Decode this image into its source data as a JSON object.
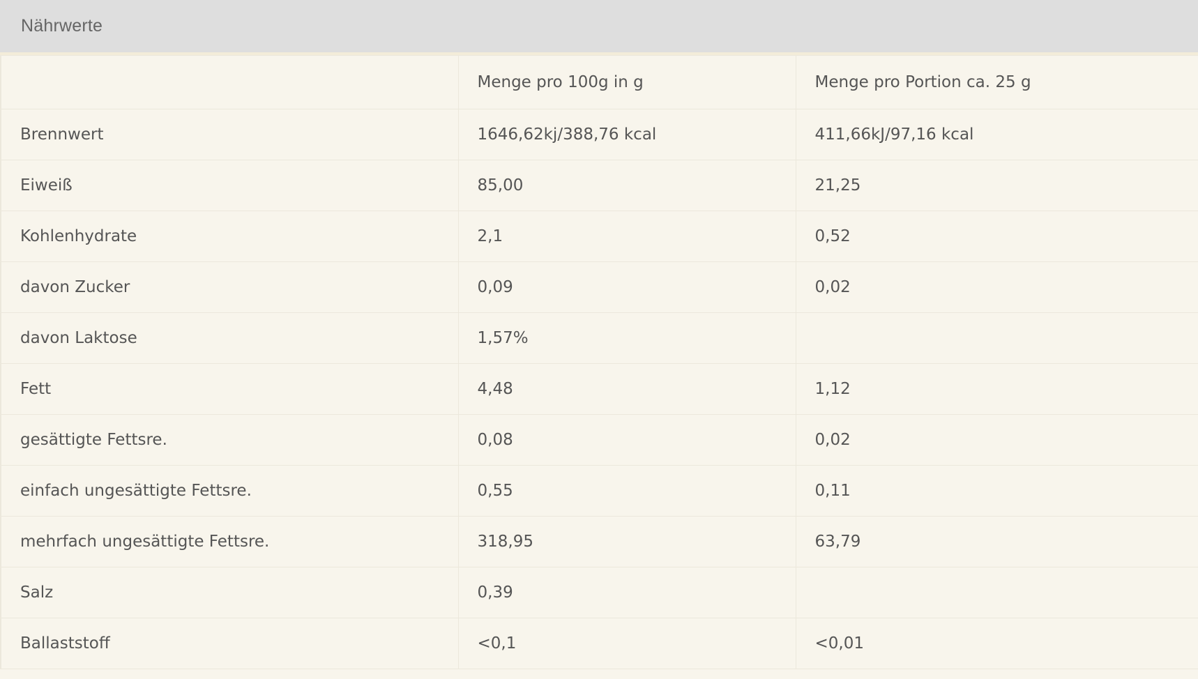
{
  "panel": {
    "title": "Nährwerte"
  },
  "table": {
    "headers": [
      "",
      "Menge pro 100g in g",
      "Menge pro Portion ca. 25 g"
    ],
    "rows": [
      [
        "Brennwert",
        "1646,62kj/388,76 kcal",
        "411,66kJ/97,16 kcal"
      ],
      [
        "Eiweiß",
        "85,00",
        "21,25"
      ],
      [
        "Kohlenhydrate",
        "2,1",
        "0,52"
      ],
      [
        "davon Zucker",
        "0,09",
        "0,02"
      ],
      [
        "davon Laktose",
        "1,57%",
        ""
      ],
      [
        "Fett",
        "4,48",
        "1,12"
      ],
      [
        "gesättigte Fettsre.",
        "0,08",
        "0,02"
      ],
      [
        "einfach ungesättigte Fettsre.",
        "0,55",
        "0,11"
      ],
      [
        "mehrfach ungesättigte Fettsre.",
        "318,95",
        "63,79"
      ],
      [
        "Salz",
        "0,39",
        ""
      ],
      [
        "Ballaststoff",
        "<0,1",
        "<0,01"
      ]
    ]
  }
}
